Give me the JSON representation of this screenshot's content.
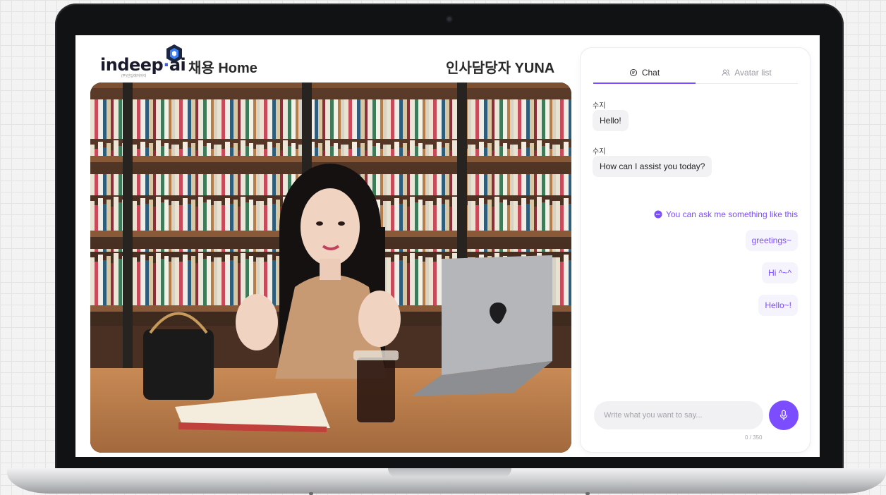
{
  "header": {
    "logo_text": "indeep·ai",
    "logo_subtext": "(주)인딥에이아이",
    "page_title": "채용 Home",
    "avatar_title": "인사담당자 YUNA"
  },
  "video": {
    "description_icon": "heart-icon"
  },
  "chat": {
    "tabs": [
      {
        "label": "Chat",
        "icon": "chat-bubble-icon",
        "active": true
      },
      {
        "label": "Avatar list",
        "icon": "users-icon",
        "active": false
      }
    ],
    "messages": [
      {
        "sender": "수지",
        "text": "Hello!"
      },
      {
        "sender": "수지",
        "text": "How can I assist you today?"
      }
    ],
    "suggestion_header": "You can ask me something like this",
    "suggestions": [
      "greetings~",
      "Hi ^~^",
      "Hello~!"
    ],
    "input": {
      "value": "",
      "placeholder": "Write what you want to say..."
    },
    "char_count": "0 / 350"
  },
  "colors": {
    "accent": "#7c4dff",
    "bubble_bg": "#f2f2f5",
    "suggestion_bg": "#f5f3fb"
  }
}
